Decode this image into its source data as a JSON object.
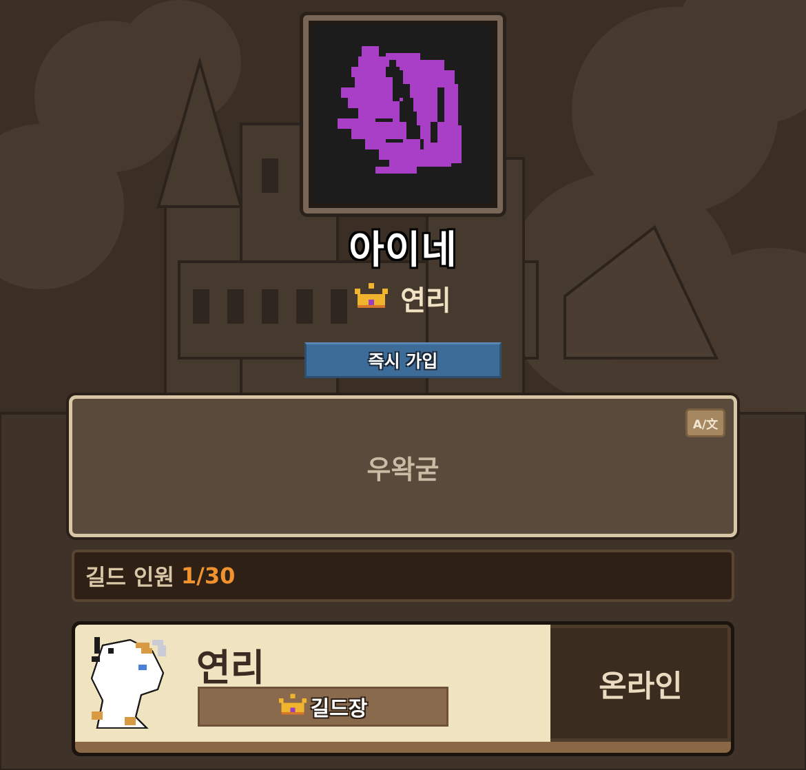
{
  "guild": {
    "name": "아이네",
    "emblem_icon": "purple-pixel-emblem-icon",
    "emblem_color": "#a93fc6",
    "leader_name": "연리",
    "join_label": "즉시 가입",
    "description": "우왁굳",
    "translate_label": "A/文",
    "member_label": "길드 인원",
    "member_count": "1/30"
  },
  "member": {
    "name": "연리",
    "rank": "길드장",
    "status": "온라인",
    "avatar_icon": "white-dragon-avatar-icon"
  },
  "colors": {
    "join_button": "#3d6c99",
    "count_accent": "#f0922e"
  }
}
